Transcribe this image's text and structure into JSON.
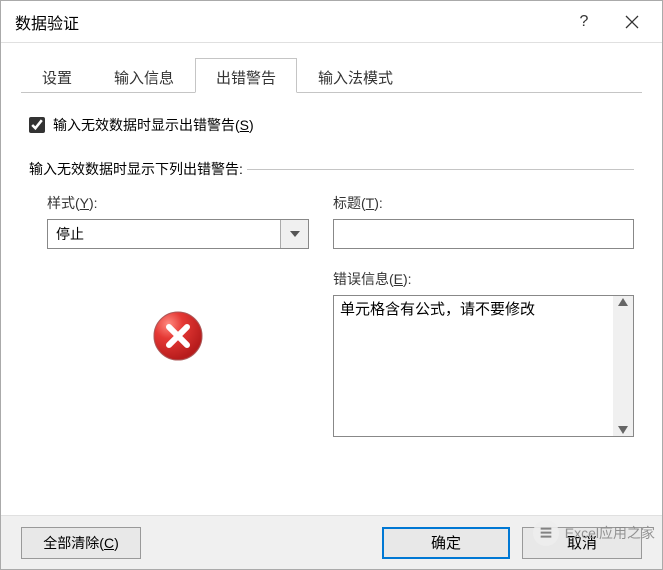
{
  "title": "数据验证",
  "titlebar": {
    "help": "?",
    "close": "close"
  },
  "tabs": {
    "items": [
      {
        "label": "设置"
      },
      {
        "label": "输入信息"
      },
      {
        "label": "出错警告"
      },
      {
        "label": "输入法模式"
      }
    ],
    "active": 2
  },
  "panel": {
    "checkbox_label_pre": "输入无效数据时显示出错警告(",
    "checkbox_hotkey": "S",
    "checkbox_label_post": ")",
    "checkbox_checked": true,
    "group_label": "输入无效数据时显示下列出错警告:",
    "style_label_pre": "样式(",
    "style_hotkey": "Y",
    "style_label_post": "):",
    "style_value": "停止",
    "title_label_pre": "标题(",
    "title_hotkey": "T",
    "title_label_post": "):",
    "title_value": "",
    "error_label_pre": "错误信息(",
    "error_hotkey": "E",
    "error_label_post": "):",
    "error_value": "单元格含有公式，请不要修改"
  },
  "footer": {
    "clear_pre": "全部清除(",
    "clear_hotkey": "C",
    "clear_post": ")",
    "ok": "确定",
    "cancel": "取消"
  },
  "watermark": "Excel应用之家"
}
